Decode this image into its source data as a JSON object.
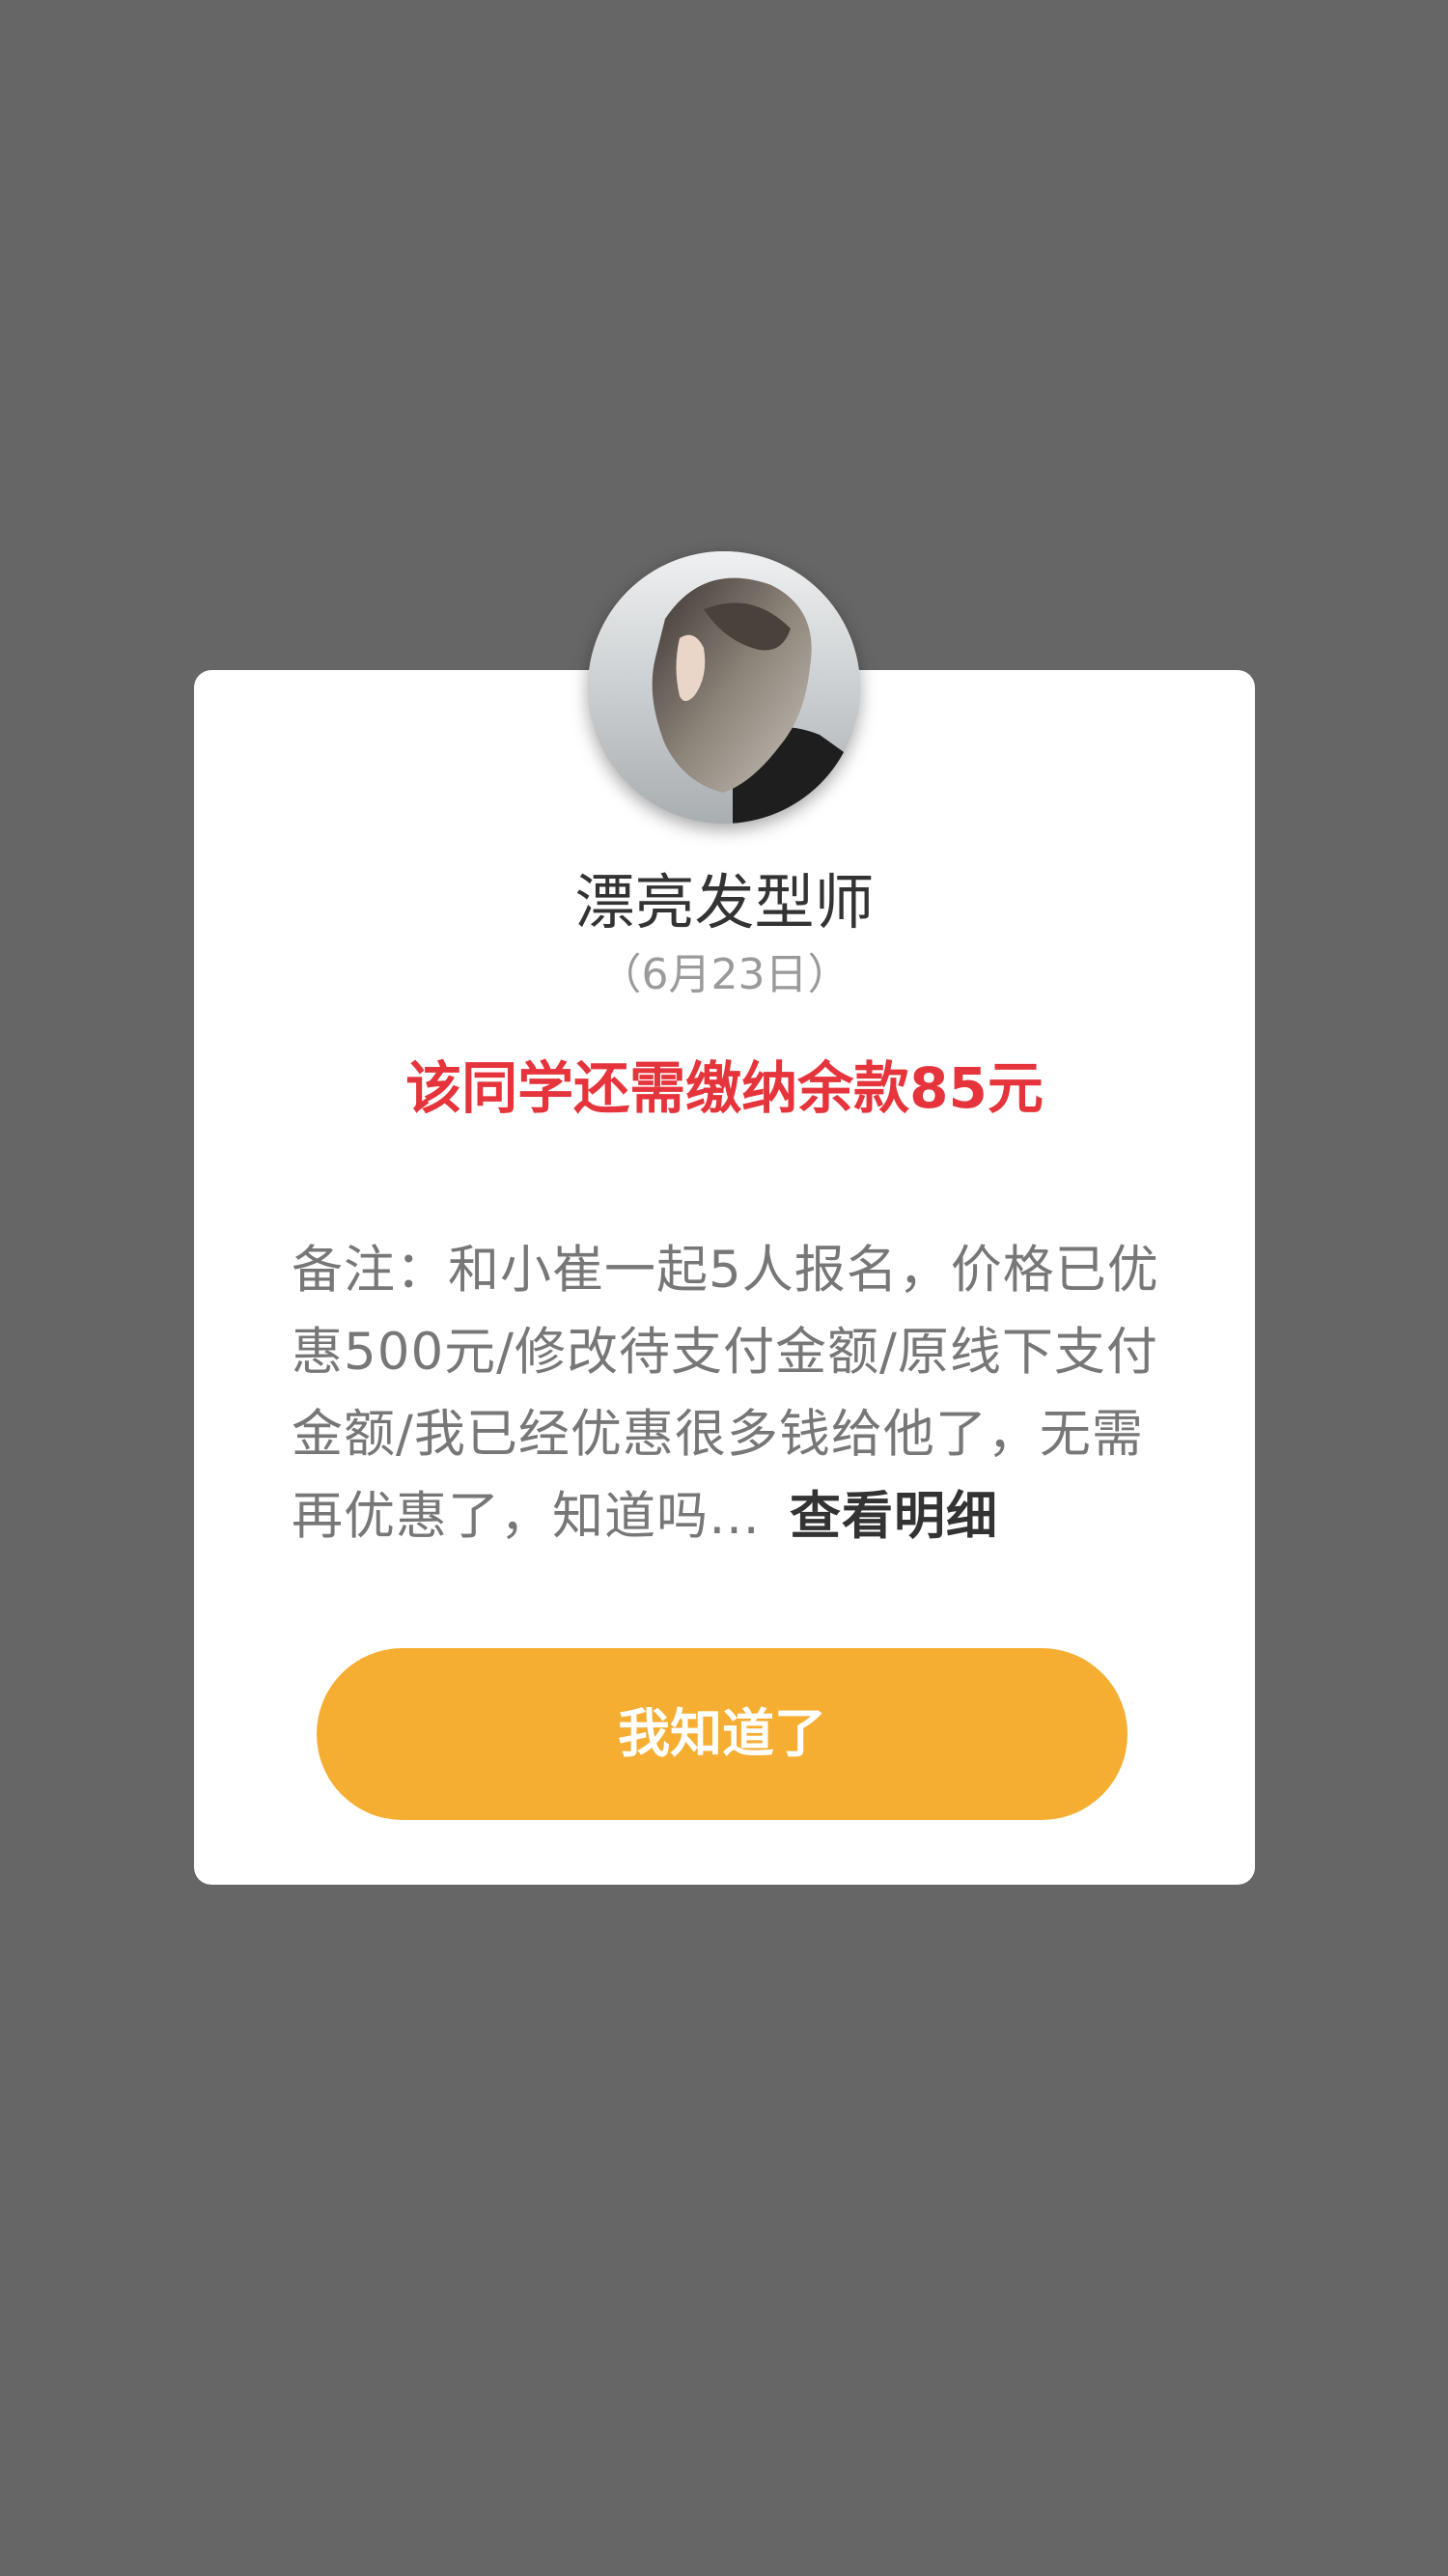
{
  "dialog": {
    "avatar_icon": "avatar-photo",
    "name": "漂亮发型师",
    "date": "（6月23日）",
    "balance_notice": "该同学还需缴纳余款85元",
    "remark_text": "备注：和小崔一起5人报名，价格已优惠500元/修改待支付金额/原线下支付金额/我已经优惠很多钱给他了，无需再优惠了，知道吗…",
    "view_details_label": "查看明细",
    "confirm_label": "我知道了"
  },
  "colors": {
    "overlay": "#666666",
    "card": "#ffffff",
    "notice_red": "#e5343b",
    "button_orange": "#f5ae32"
  }
}
